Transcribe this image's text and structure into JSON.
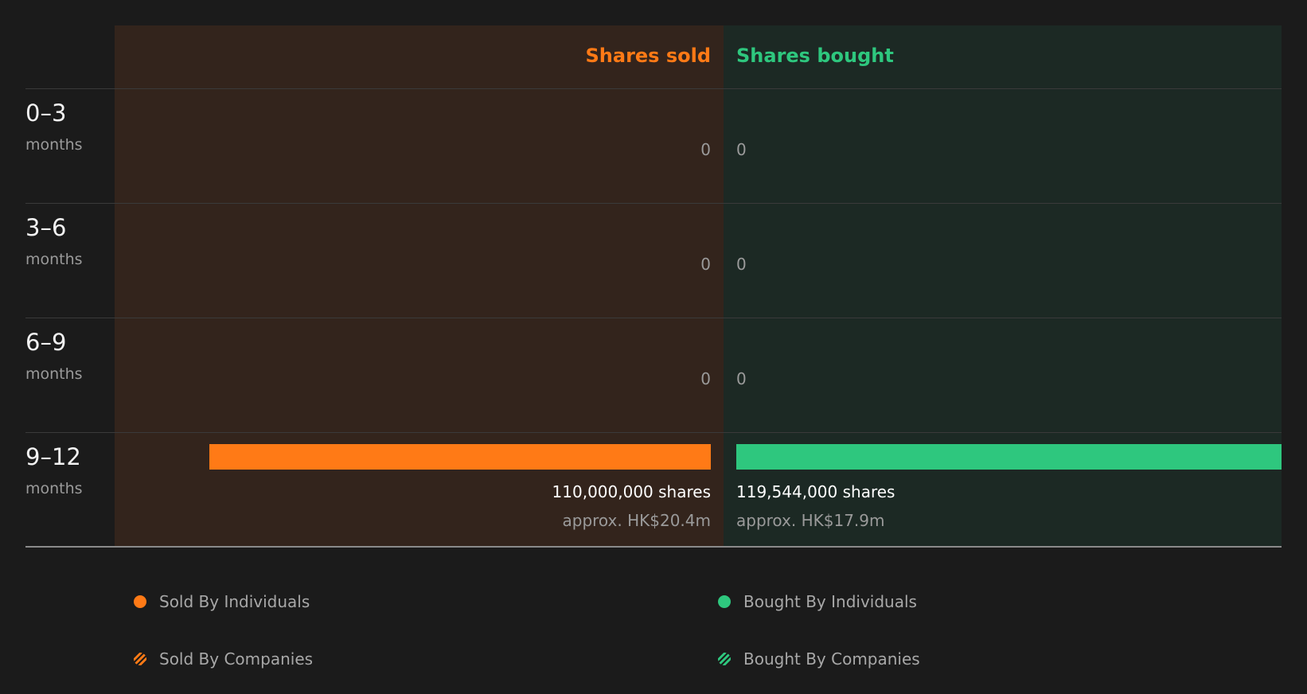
{
  "colors": {
    "sold": "#ff7a16",
    "bought": "#2ec77e"
  },
  "headers": {
    "sold": "Shares sold",
    "bought": "Shares bought"
  },
  "chart_data": {
    "type": "bar",
    "orientation": "horizontal-diverging",
    "categories": [
      "0–3 months",
      "3–6 months",
      "6–9 months",
      "9–12 months"
    ],
    "series": [
      {
        "name": "Shares sold",
        "values": [
          0,
          0,
          0,
          110000000
        ],
        "approx_value": [
          "",
          "",
          "",
          "approx. HK$20.4m"
        ]
      },
      {
        "name": "Shares bought",
        "values": [
          0,
          0,
          0,
          119544000
        ],
        "approx_value": [
          "",
          "",
          "",
          "approx. HK$17.9m"
        ]
      }
    ],
    "legend_placement": "bottom"
  },
  "rows": [
    {
      "period": "0–3",
      "unit": "months",
      "sold_text": "0",
      "bought_text": "0",
      "sold_approx": "",
      "bought_approx": ""
    },
    {
      "period": "3–6",
      "unit": "months",
      "sold_text": "0",
      "bought_text": "0",
      "sold_approx": "",
      "bought_approx": ""
    },
    {
      "period": "6–9",
      "unit": "months",
      "sold_text": "0",
      "bought_text": "0",
      "sold_approx": "",
      "bought_approx": ""
    },
    {
      "period": "9–12",
      "unit": "months",
      "sold_text": "110,000,000 shares",
      "bought_text": "119,544,000 shares",
      "sold_approx": "approx. HK$20.4m",
      "bought_approx": "approx. HK$17.9m"
    }
  ],
  "legend": [
    {
      "label": "Sold By Individuals",
      "icon": "solid-dot",
      "color": "#ff7a16"
    },
    {
      "label": "Bought By Individuals",
      "icon": "solid-dot",
      "color": "#2ec77e"
    },
    {
      "label": "Sold By Companies",
      "icon": "striped-dot",
      "color": "#ff7a16"
    },
    {
      "label": "Bought By Companies",
      "icon": "striped-dot",
      "color": "#2ec77e"
    }
  ]
}
